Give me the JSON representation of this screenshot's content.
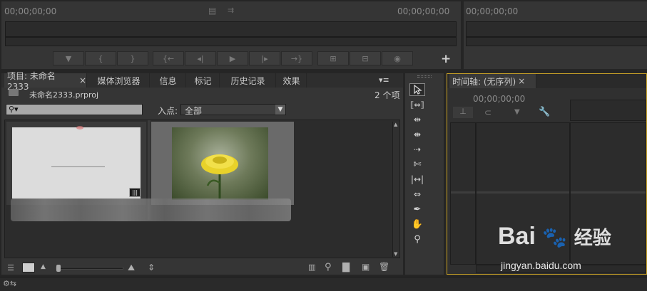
{
  "source_monitor": {
    "timecode_in": "00;00;00;00",
    "timecode_out": "00;00;00;00",
    "plus_label": "+"
  },
  "program_monitor": {
    "timecode": "00;00;00;00"
  },
  "project_panel": {
    "tabs": [
      {
        "label": "项目: 未命名2333",
        "close": "×"
      },
      {
        "label": "媒体浏览器"
      },
      {
        "label": "信息"
      },
      {
        "label": "标记"
      },
      {
        "label": "历史记录"
      },
      {
        "label": "效果"
      }
    ],
    "menu_glyph": "▾≡",
    "file_name": "未命名2333.prproj",
    "item_count": "2 个项",
    "search_glyph": "⚲▾",
    "in_point_label": "入点:",
    "in_point_value": "全部"
  },
  "timeline_panel": {
    "tab_label": "时间轴: (无序列)",
    "close": "×",
    "timecode": "00;00;00;00"
  },
  "watermark": {
    "brand": "Bai",
    "brand_suffix": "经验",
    "url": "jingyan.baidu.com"
  },
  "colors": {
    "panel": "#353535",
    "frame": "#252525",
    "timeline_border": "#c9a227",
    "flower": "#e8d22a"
  }
}
